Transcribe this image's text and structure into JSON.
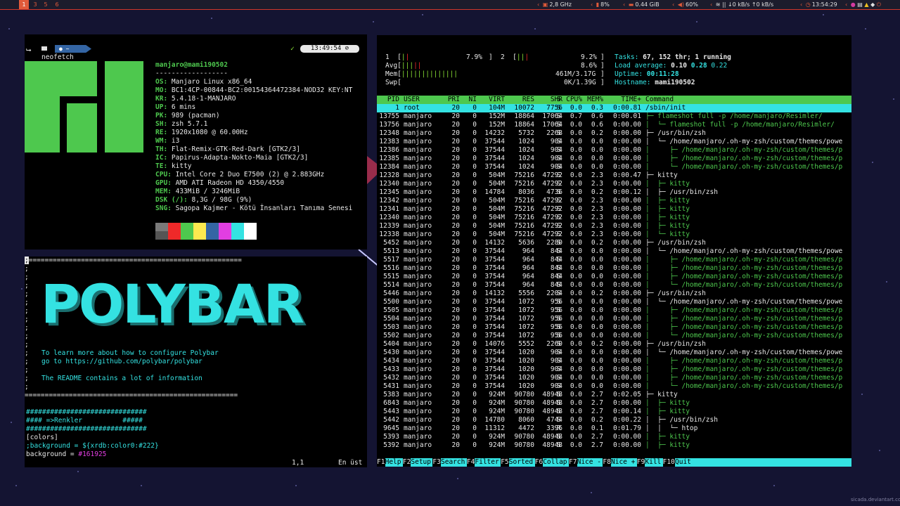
{
  "bar": {
    "workspaces": [
      "1",
      "3",
      "5",
      "6"
    ],
    "cpu": "2,8 GHz",
    "cpu_load": "8%",
    "memory": "0.44 GiB",
    "volume": "60%",
    "net_down": "0 kB/s",
    "net_up": "0 kB/s",
    "clock": "13:54:29"
  },
  "neofetch": {
    "prompt_tag": "~",
    "clock": "13:49:54",
    "command": "neofetch",
    "user_host": "manjaro@mami190502",
    "separator": "------------------",
    "info": [
      {
        "label": "OS:",
        "value": "Manjaro Linux x86_64"
      },
      {
        "label": "MO:",
        "value": "BC1:4CP-00844-BC2:00154364472384-NOD32 KEY:NT"
      },
      {
        "label": "KR:",
        "value": "5.4.18-1-MANJARO"
      },
      {
        "label": "UP:",
        "value": "6 mins"
      },
      {
        "label": "PK:",
        "value": "989 (pacman)"
      },
      {
        "label": "SH:",
        "value": "zsh 5.7.1"
      },
      {
        "label": "RE:",
        "value": "1920x1080 @ 60.00Hz"
      },
      {
        "label": "WM:",
        "value": "i3"
      },
      {
        "label": "TH:",
        "value": "Flat-Remix-GTK-Red-Dark [GTK2/3]"
      },
      {
        "label": "IC:",
        "value": "Papirus-Adapta-Nokto-Maia [GTK2/3]"
      },
      {
        "label": "TE:",
        "value": "kitty"
      },
      {
        "label": "CPU:",
        "value": "Intel Core 2 Duo E7500 (2) @ 2.883GHz"
      },
      {
        "label": "GPU:",
        "value": "AMD ATI Radeon HD 4350/4550"
      },
      {
        "label": "MEM:",
        "value": "433MiB / 3246MiB"
      },
      {
        "label": "DSK (/):",
        "value": "8,3G / 98G (9%)"
      },
      {
        "label": "SNG:",
        "value": "Sagopa Kajmer - Kötü İnsanları Tanıma Senesi"
      }
    ],
    "palette": [
      "#7a7a7a",
      "#ef2929",
      "#4ec84e",
      "#fce94f",
      "#3465a4",
      "#e23ee2",
      "#34e2e2",
      "#ffffff"
    ]
  },
  "vim": {
    "border_line": "=====================================================",
    "logo": "POLYBAR",
    "comment1": "To learn more about how to configure Polybar",
    "comment2": "go to https://github.com/polybar/polybar",
    "comment3": "The README contains a lot of information",
    "hash_line": "##############################",
    "section_comment": "#### =>Renkler          #####",
    "colors_header": "[colors]",
    "bg_comment": ";background = ${xrdb:color0:#222}",
    "bg_key": "background = ",
    "bg_value": "#161925",
    "position": "1,1",
    "scroll": "En üst"
  },
  "htop": {
    "cpu1_label": "1",
    "cpu1_pct": "7.9%",
    "cpu2_label": "2",
    "cpu2_pct": "9.2%",
    "avg_label": "Avg",
    "avg_pct": "8.6%",
    "mem_label": "Mem",
    "mem_value": "461M/3.17G",
    "swp_label": "Swp",
    "swp_value": "0K/1.39G",
    "tasks_label": "Tasks:",
    "tasks_value": "67, 152 thr; 1 running",
    "load_label": "Load average:",
    "load_1": "0.10",
    "load_5": "0.28",
    "load_15": "0.22",
    "uptime_label": "Uptime:",
    "uptime_value": "00:11:28",
    "host_label": "Hostname:",
    "host_value": "mami190502",
    "columns": [
      "PID",
      "USER",
      "PRI",
      "NI",
      "VIRT",
      "RES",
      "SHR",
      "S",
      "CPU%",
      "MEM%",
      "TIME+",
      "Command"
    ],
    "rows": [
      [
        "1",
        "root",
        "20",
        "0",
        "104M",
        "10072",
        "7756",
        "S",
        "0.0",
        "0.3",
        "0:00.81",
        "/sbin/init"
      ],
      [
        "13755",
        "manjaro",
        "20",
        "0",
        "152M",
        "18864",
        "17064",
        "S",
        "0.7",
        "0.6",
        "0:00.01",
        "├─ flameshot full -p /home/manjaro/Resimler/"
      ],
      [
        "13756",
        "manjaro",
        "20",
        "0",
        "152M",
        "18864",
        "17064",
        "S",
        "0.0",
        "0.6",
        "0:00.00",
        "│  └─ flameshot full -p /home/manjaro/Resimler/"
      ],
      [
        "12348",
        "manjaro",
        "20",
        "0",
        "14232",
        "5732",
        "2268",
        "S",
        "0.0",
        "0.2",
        "0:00.00",
        "├─ /usr/bin/zsh"
      ],
      [
        "12383",
        "manjaro",
        "20",
        "0",
        "37544",
        "1024",
        "904",
        "S",
        "0.0",
        "0.0",
        "0:00.00",
        "│  └─ /home/manjaro/.oh-my-zsh/custom/themes/powe"
      ],
      [
        "12386",
        "manjaro",
        "20",
        "0",
        "37544",
        "1024",
        "904",
        "S",
        "0.0",
        "0.0",
        "0:00.00",
        "│     ├─ /home/manjaro/.oh-my-zsh/custom/themes/p"
      ],
      [
        "12385",
        "manjaro",
        "20",
        "0",
        "37544",
        "1024",
        "904",
        "S",
        "0.0",
        "0.0",
        "0:00.00",
        "│     ├─ /home/manjaro/.oh-my-zsh/custom/themes/p"
      ],
      [
        "12384",
        "manjaro",
        "20",
        "0",
        "37544",
        "1024",
        "904",
        "S",
        "0.0",
        "0.0",
        "0:00.00",
        "│     └─ /home/manjaro/.oh-my-zsh/custom/themes/p"
      ],
      [
        "12328",
        "manjaro",
        "20",
        "0",
        "504M",
        "75216",
        "47292",
        "S",
        "0.0",
        "2.3",
        "0:00.47",
        "├─ kitty"
      ],
      [
        "12340",
        "manjaro",
        "20",
        "0",
        "504M",
        "75216",
        "47292",
        "S",
        "0.0",
        "2.3",
        "0:00.00",
        "│  ├─ kitty"
      ],
      [
        "12345",
        "manjaro",
        "20",
        "0",
        "14784",
        "8036",
        "4736",
        "S",
        "0.0",
        "0.2",
        "0:00.12",
        "│  ├─ /usr/bin/zsh"
      ],
      [
        "12342",
        "manjaro",
        "20",
        "0",
        "504M",
        "75216",
        "47292",
        "S",
        "0.0",
        "2.3",
        "0:00.00",
        "│  ├─ kitty"
      ],
      [
        "12341",
        "manjaro",
        "20",
        "0",
        "504M",
        "75216",
        "47292",
        "S",
        "0.0",
        "2.3",
        "0:00.00",
        "│  ├─ kitty"
      ],
      [
        "12340",
        "manjaro",
        "20",
        "0",
        "504M",
        "75216",
        "47292",
        "S",
        "0.0",
        "2.3",
        "0:00.00",
        "│  ├─ kitty"
      ],
      [
        "12339",
        "manjaro",
        "20",
        "0",
        "504M",
        "75216",
        "47292",
        "S",
        "0.0",
        "2.3",
        "0:00.00",
        "│  ├─ kitty"
      ],
      [
        "12338",
        "manjaro",
        "20",
        "0",
        "504M",
        "75216",
        "47292",
        "S",
        "0.0",
        "2.3",
        "0:00.00",
        "│  └─ kitty"
      ],
      [
        "5452",
        "manjaro",
        "20",
        "0",
        "14132",
        "5636",
        "2280",
        "S",
        "0.0",
        "0.2",
        "0:00.00",
        "├─ /usr/bin/zsh"
      ],
      [
        "5513",
        "manjaro",
        "20",
        "0",
        "37544",
        "964",
        "844",
        "S",
        "0.0",
        "0.0",
        "0:00.00",
        "│  └─ /home/manjaro/.oh-my-zsh/custom/themes/powe"
      ],
      [
        "5517",
        "manjaro",
        "20",
        "0",
        "37544",
        "964",
        "844",
        "S",
        "0.0",
        "0.0",
        "0:00.00",
        "│     ├─ /home/manjaro/.oh-my-zsh/custom/themes/p"
      ],
      [
        "5516",
        "manjaro",
        "20",
        "0",
        "37544",
        "964",
        "844",
        "S",
        "0.0",
        "0.0",
        "0:00.00",
        "│     ├─ /home/manjaro/.oh-my-zsh/custom/themes/p"
      ],
      [
        "5515",
        "manjaro",
        "20",
        "0",
        "37544",
        "964",
        "844",
        "S",
        "0.0",
        "0.0",
        "0:00.00",
        "│     ├─ /home/manjaro/.oh-my-zsh/custom/themes/p"
      ],
      [
        "5514",
        "manjaro",
        "20",
        "0",
        "37544",
        "964",
        "844",
        "S",
        "0.0",
        "0.0",
        "0:00.00",
        "│     └─ /home/manjaro/.oh-my-zsh/custom/themes/p"
      ],
      [
        "5446",
        "manjaro",
        "20",
        "0",
        "14132",
        "5556",
        "2204",
        "S",
        "0.0",
        "0.2",
        "0:00.00",
        "├─ /usr/bin/zsh"
      ],
      [
        "5500",
        "manjaro",
        "20",
        "0",
        "37544",
        "1072",
        "956",
        "S",
        "0.0",
        "0.0",
        "0:00.00",
        "│  └─ /home/manjaro/.oh-my-zsh/custom/themes/powe"
      ],
      [
        "5505",
        "manjaro",
        "20",
        "0",
        "37544",
        "1072",
        "956",
        "S",
        "0.0",
        "0.0",
        "0:00.00",
        "│     ├─ /home/manjaro/.oh-my-zsh/custom/themes/p"
      ],
      [
        "5504",
        "manjaro",
        "20",
        "0",
        "37544",
        "1072",
        "956",
        "S",
        "0.0",
        "0.0",
        "0:00.00",
        "│     ├─ /home/manjaro/.oh-my-zsh/custom/themes/p"
      ],
      [
        "5503",
        "manjaro",
        "20",
        "0",
        "37544",
        "1072",
        "956",
        "S",
        "0.0",
        "0.0",
        "0:00.00",
        "│     ├─ /home/manjaro/.oh-my-zsh/custom/themes/p"
      ],
      [
        "5502",
        "manjaro",
        "20",
        "0",
        "37544",
        "1072",
        "956",
        "S",
        "0.0",
        "0.0",
        "0:00.00",
        "│     └─ /home/manjaro/.oh-my-zsh/custom/themes/p"
      ],
      [
        "5404",
        "manjaro",
        "20",
        "0",
        "14076",
        "5552",
        "2260",
        "S",
        "0.0",
        "0.2",
        "0:00.00",
        "├─ /usr/bin/zsh"
      ],
      [
        "5430",
        "manjaro",
        "20",
        "0",
        "37544",
        "1020",
        "904",
        "S",
        "0.0",
        "0.0",
        "0:00.00",
        "│  └─ /home/manjaro/.oh-my-zsh/custom/themes/powe"
      ],
      [
        "5434",
        "manjaro",
        "20",
        "0",
        "37544",
        "1020",
        "904",
        "S",
        "0.0",
        "0.0",
        "0:00.00",
        "│     ├─ /home/manjaro/.oh-my-zsh/custom/themes/p"
      ],
      [
        "5433",
        "manjaro",
        "20",
        "0",
        "37544",
        "1020",
        "904",
        "S",
        "0.0",
        "0.0",
        "0:00.00",
        "│     ├─ /home/manjaro/.oh-my-zsh/custom/themes/p"
      ],
      [
        "5432",
        "manjaro",
        "20",
        "0",
        "37544",
        "1020",
        "904",
        "S",
        "0.0",
        "0.0",
        "0:00.00",
        "│     ├─ /home/manjaro/.oh-my-zsh/custom/themes/p"
      ],
      [
        "5431",
        "manjaro",
        "20",
        "0",
        "37544",
        "1020",
        "904",
        "S",
        "0.0",
        "0.0",
        "0:00.00",
        "│     └─ /home/manjaro/.oh-my-zsh/custom/themes/p"
      ],
      [
        "5383",
        "manjaro",
        "20",
        "0",
        "924M",
        "90780",
        "48948",
        "S",
        "0.0",
        "2.7",
        "0:02.05",
        "├─ kitty"
      ],
      [
        "6843",
        "manjaro",
        "20",
        "0",
        "924M",
        "90780",
        "48948",
        "S",
        "0.0",
        "2.7",
        "0:00.00",
        "│  ├─ kitty"
      ],
      [
        "5443",
        "manjaro",
        "20",
        "0",
        "924M",
        "90780",
        "48948",
        "S",
        "0.0",
        "2.7",
        "0:00.14",
        "│  ├─ kitty"
      ],
      [
        "5442",
        "manjaro",
        "20",
        "0",
        "14780",
        "8060",
        "4744",
        "S",
        "0.0",
        "0.2",
        "0:00.22",
        "│  ├─ /usr/bin/zsh"
      ],
      [
        "9645",
        "manjaro",
        "20",
        "0",
        "11312",
        "4472",
        "3396",
        "R",
        "0.0",
        "0.1",
        "0:01.79",
        "│  │  └─ htop"
      ],
      [
        "5393",
        "manjaro",
        "20",
        "0",
        "924M",
        "90780",
        "48948",
        "S",
        "0.0",
        "2.7",
        "0:00.00",
        "│  ├─ kitty"
      ],
      [
        "5392",
        "manjaro",
        "20",
        "0",
        "924M",
        "90780",
        "48948",
        "S",
        "0.0",
        "2.7",
        "0:00.00",
        "│  ├─ kitty"
      ]
    ],
    "fkeys": [
      {
        "k": "F1",
        "l": "Help"
      },
      {
        "k": "F2",
        "l": "Setup"
      },
      {
        "k": "F3",
        "l": "Search"
      },
      {
        "k": "F4",
        "l": "Filter"
      },
      {
        "k": "F5",
        "l": "Sorted"
      },
      {
        "k": "F6",
        "l": "Collap"
      },
      {
        "k": "F7",
        "l": "Nice -"
      },
      {
        "k": "F8",
        "l": "Nice +"
      },
      {
        "k": "F9",
        "l": "Kill"
      },
      {
        "k": "F10",
        "l": "Quit"
      }
    ]
  },
  "watermark": "sicada.deviantart.com"
}
